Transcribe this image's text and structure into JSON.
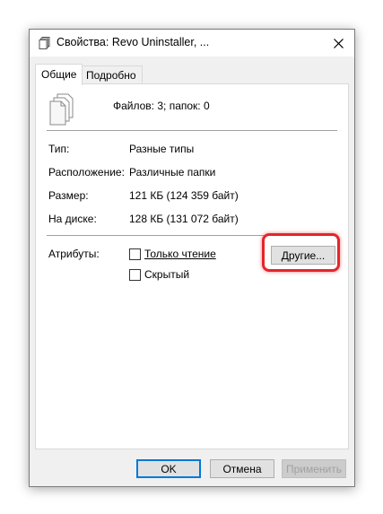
{
  "window": {
    "title": "Свойства: Revo Uninstaller, ..."
  },
  "tabs": [
    {
      "label": "Общие",
      "active": true
    },
    {
      "label": "Подробно",
      "active": false
    }
  ],
  "general": {
    "summary": "Файлов: 3; папок: 0",
    "properties": [
      {
        "label": "Тип:",
        "value": "Разные типы"
      },
      {
        "label": "Расположение:",
        "value": "Различные папки"
      },
      {
        "label": "Размер:",
        "value": "121 КБ (124 359 байт)"
      },
      {
        "label": "На диске:",
        "value": "128 КБ (131 072 байт)"
      }
    ],
    "attributes": {
      "label": "Атрибуты:",
      "readonly_label": "Только чтение",
      "readonly_checked": false,
      "hidden_label": "Скрытый",
      "hidden_checked": false,
      "other_button": "Другие..."
    }
  },
  "footer": {
    "ok": "OK",
    "cancel": "Отмена",
    "apply": "Применить"
  },
  "colors": {
    "highlight": "#e3262b",
    "accent": "#0078d7"
  },
  "icons": {
    "title": "files-stack-icon",
    "close": "close-icon",
    "files": "files-stack-icon"
  }
}
